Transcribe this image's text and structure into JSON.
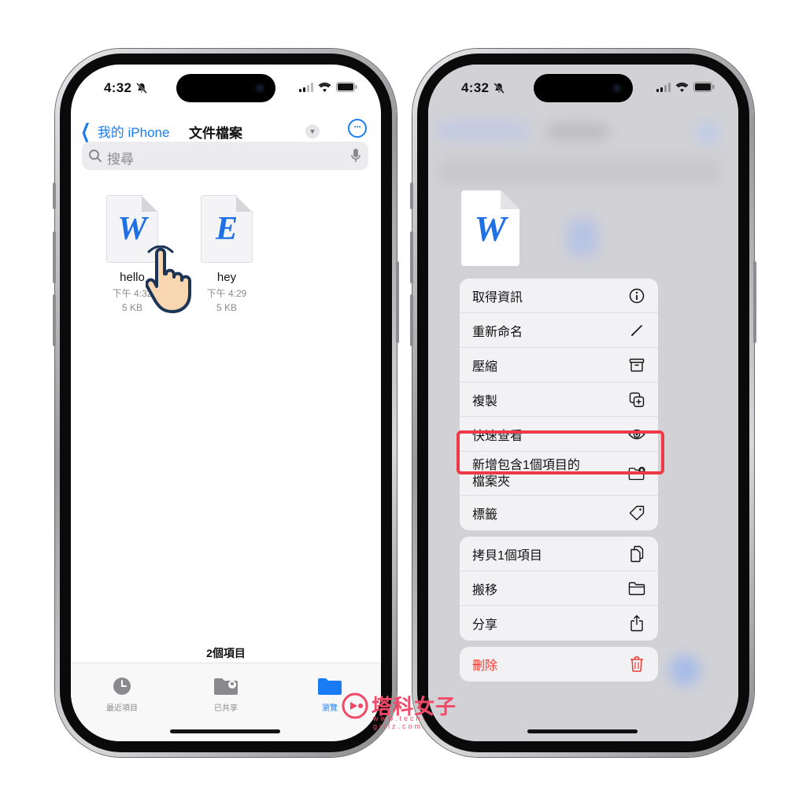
{
  "left_phone": {
    "status": {
      "time": "4:32"
    },
    "nav": {
      "back_label": "我的 iPhone",
      "title": "文件檔案",
      "more_label": "···"
    },
    "search": {
      "placeholder": "搜尋"
    },
    "files": [
      {
        "letter": "W",
        "name": "hello",
        "time": "下午 4:32",
        "size": "5 KB"
      },
      {
        "letter": "E",
        "name": "hey",
        "time": "下午 4:29",
        "size": "5 KB"
      }
    ],
    "item_count": "2個項目",
    "tabs": [
      {
        "label": "最近項目",
        "icon": "clock-icon",
        "active": false
      },
      {
        "label": "已共享",
        "icon": "shared-folder-icon",
        "active": false
      },
      {
        "label": "瀏覽",
        "icon": "folder-icon",
        "active": true
      }
    ]
  },
  "right_phone": {
    "status": {
      "time": "4:32"
    },
    "preview_letter": "W",
    "menu_groups": [
      [
        {
          "label": "取得資訊",
          "icon": "info-icon"
        },
        {
          "label": "重新命名",
          "icon": "pencil-icon"
        },
        {
          "label": "壓縮",
          "icon": "archive-icon"
        },
        {
          "label": "複製",
          "icon": "duplicate-icon"
        },
        {
          "label": "快速查看",
          "icon": "eye-icon",
          "highlighted": true
        },
        {
          "label": "新增包含1個項目的\n檔案夾",
          "icon": "new-folder-icon"
        },
        {
          "label": "標籤",
          "icon": "tag-icon"
        }
      ],
      [
        {
          "label": "拷貝1個項目",
          "icon": "copy-icon"
        },
        {
          "label": "搬移",
          "icon": "folder-icon"
        },
        {
          "label": "分享",
          "icon": "share-icon"
        }
      ],
      [
        {
          "label": "刪除",
          "icon": "trash-icon",
          "destructive": true
        }
      ]
    ]
  },
  "watermark": {
    "text": "塔科女子",
    "sub": "www.tech-girlz.com"
  },
  "colors": {
    "accent": "#1a7cf5",
    "destructive": "#ec3b32",
    "highlight": "#ee3a48",
    "watermark": "#f04a68"
  }
}
